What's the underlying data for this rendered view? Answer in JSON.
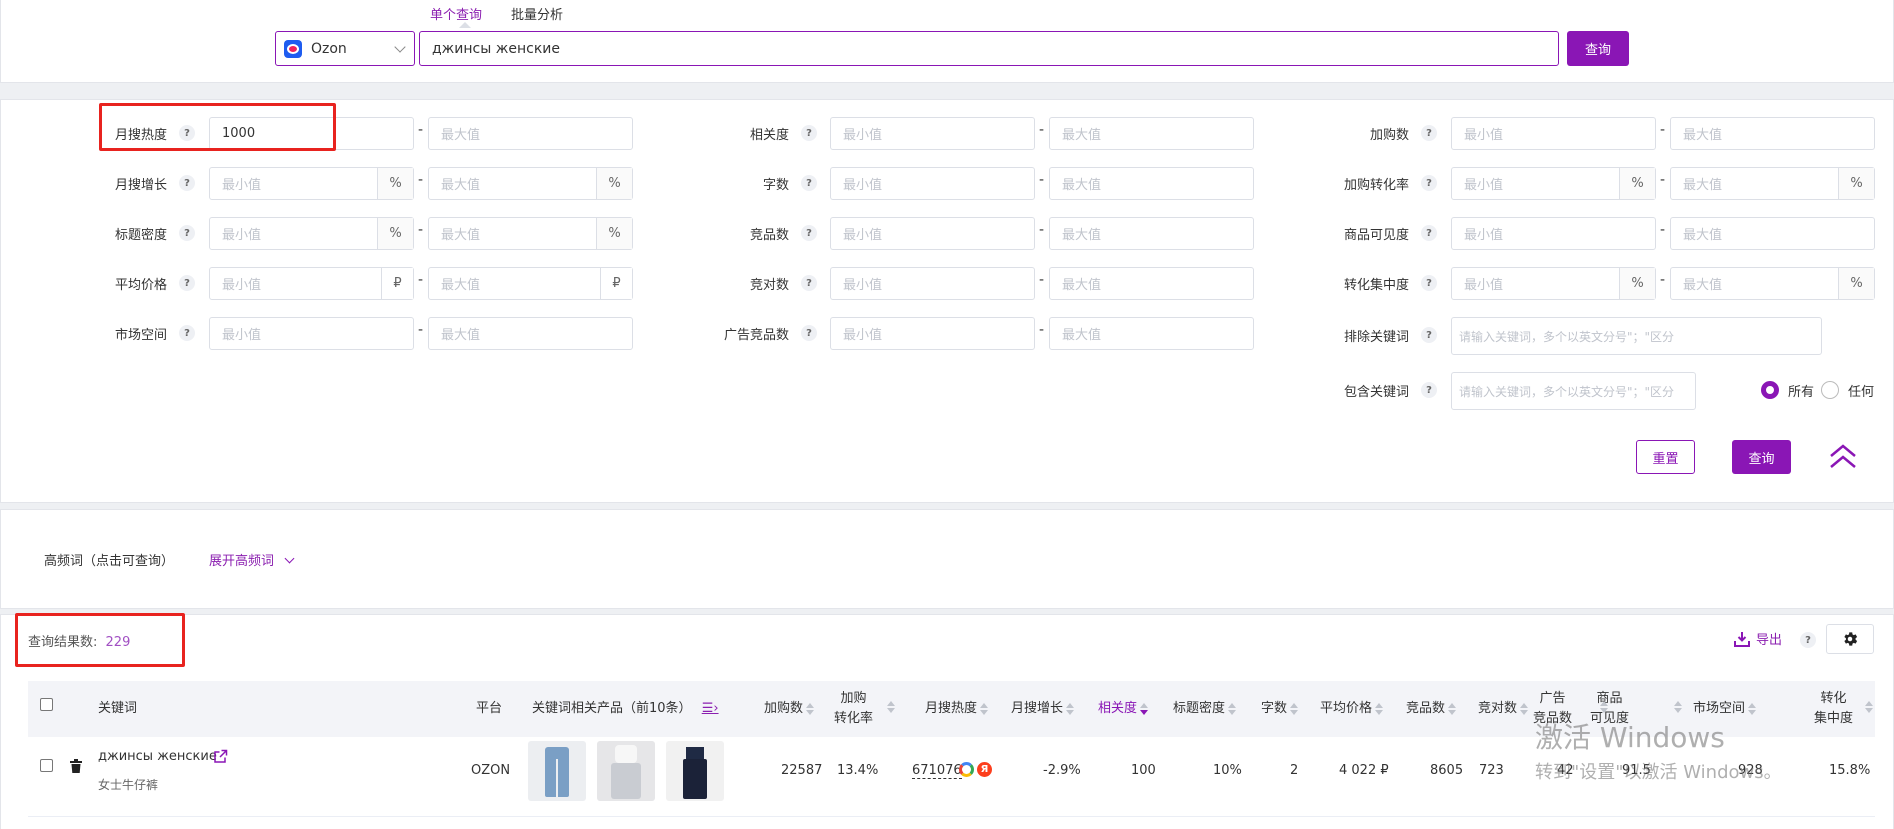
{
  "tabs": {
    "single": "单个查询",
    "batch": "批量分析"
  },
  "search": {
    "platform": "Ozon",
    "query": "джинсы женские",
    "button": "查询"
  },
  "filters": {
    "min_ph": "最小值",
    "max_ph": "最大值",
    "kw_ph": "请输入关键词，多个以英文分号\"；\"区分",
    "monthly_search": "月搜热度",
    "monthly_search_min": "1000",
    "monthly_growth": "月搜增长",
    "title_density": "标题密度",
    "avg_price": "平均价格",
    "market_space": "市场空间",
    "relevance": "相关度",
    "word_count": "字数",
    "competitors": "竞品数",
    "bids": "竞对数",
    "ad_competitors": "广告竞品数",
    "cart_adds": "加购数",
    "cart_conv": "加购转化率",
    "visibility": "商品可见度",
    "conv_concentration": "转化集中度",
    "exclude_kw": "排除关键词",
    "include_kw": "包含关键词",
    "unit_pct": "%",
    "unit_rub": "₽",
    "match_all": "所有",
    "match_any": "任何",
    "reset": "重置",
    "query": "查询"
  },
  "high_freq": {
    "label": "高频词（点击可查询）",
    "expand": "展开高频词"
  },
  "results": {
    "label": "查询结果数:",
    "count": "229",
    "export": "导出"
  },
  "table": {
    "headers": {
      "keyword": "关键词",
      "platform": "平台",
      "products": "关键词相关产品（前10条）",
      "cart": "加购数",
      "cart_conv_1": "加购",
      "cart_conv_2": "转化率",
      "monthly": "月搜热度",
      "growth": "月搜增长",
      "relevance": "相关度",
      "density": "标题密度",
      "words": "字数",
      "price": "平均价格",
      "comp": "竞品数",
      "bids": "竞对数",
      "ad_1": "广告",
      "ad_2": "竞品数",
      "vis_1": "商品",
      "vis_2": "可见度",
      "market": "市场空间",
      "conc_1": "转化",
      "conc_2": "集中度"
    },
    "rows": [
      {
        "keyword": "джинсы женские",
        "translation": "女士牛仔裤",
        "platform": "OZON",
        "cart": "22587",
        "cart_conv": "13.4%",
        "monthly": "671076",
        "growth": "-2.9%",
        "relevance": "100",
        "density": "10%",
        "words": "2",
        "price": "4 022 ₽",
        "comp": "8605",
        "bids": "723",
        "ad": "42",
        "vis": "91.5",
        "market": "928",
        "conc": "15.8%"
      }
    ]
  },
  "watermark": {
    "line1": "激活 Windows",
    "line2": "转到\"设置\"以激活 Windows。"
  },
  "colors": {
    "accent": "#8a16b5",
    "highlight": "#e8231f"
  }
}
